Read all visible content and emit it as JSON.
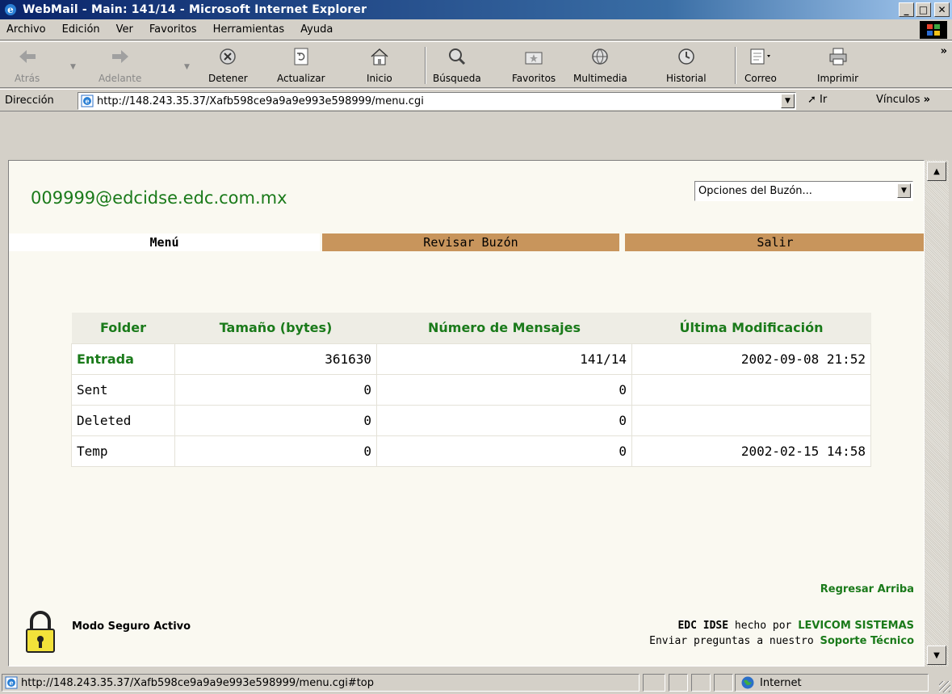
{
  "window": {
    "title": "WebMail - Main: 141/14 - Microsoft Internet Explorer",
    "min_glyph": "_",
    "max_glyph": "□",
    "close_glyph": "✕"
  },
  "menu": [
    "Archivo",
    "Edición",
    "Ver",
    "Favoritos",
    "Herramientas",
    "Ayuda"
  ],
  "toolbar": {
    "back": "Atrás",
    "forward": "Adelante",
    "stop": "Detener",
    "refresh": "Actualizar",
    "home": "Inicio",
    "search": "Búsqueda",
    "favorites": "Favoritos",
    "media": "Multimedia",
    "history": "Historial",
    "mail": "Correo",
    "print": "Imprimir",
    "more": "»"
  },
  "address": {
    "label": "Dirección",
    "url": "http://148.243.35.37/Xafb598ce9a9a9e993e598999/menu.cgi",
    "go": "Ir",
    "links": "Vínculos"
  },
  "page": {
    "email": "009999@edcidse.edc.com.mx",
    "mailbox_options": "Opciones del Buzón...",
    "nav": {
      "menu": "Menú",
      "check": "Revisar Buzón",
      "exit": "Salir"
    },
    "table": {
      "headers": [
        "Folder",
        "Tamaño (bytes)",
        "Número de Mensajes",
        "Última Modificación"
      ],
      "rows": [
        {
          "folder": "Entrada",
          "size": "361630",
          "messages": "141/14",
          "modified": "2002-09-08 21:52"
        },
        {
          "folder": "Sent",
          "size": "0",
          "messages": "0",
          "modified": ""
        },
        {
          "folder": "Deleted",
          "size": "0",
          "messages": "0",
          "modified": ""
        },
        {
          "folder": "Temp",
          "size": "0",
          "messages": "0",
          "modified": "2002-02-15 14:58"
        }
      ]
    },
    "back_to_top": "Regresar Arriba",
    "secure_mode": "Modo Seguro Activo",
    "credit_brand": "EDC IDSE",
    "credit_made_by": "hecho por",
    "credit_company": "LEVICOM SISTEMAS",
    "credit_questions": "Enviar preguntas a nuestro",
    "credit_support": "Soporte Técnico"
  },
  "status": {
    "url": "http://148.243.35.37/Xafb598ce9a9a9e993e598999/menu.cgi#top",
    "zone": "Internet"
  },
  "colors": {
    "title_bar": "#0a246a",
    "green_text": "#1a7a1a",
    "nav_tab": "#c8955c",
    "page_bg": "#faf9f1"
  }
}
